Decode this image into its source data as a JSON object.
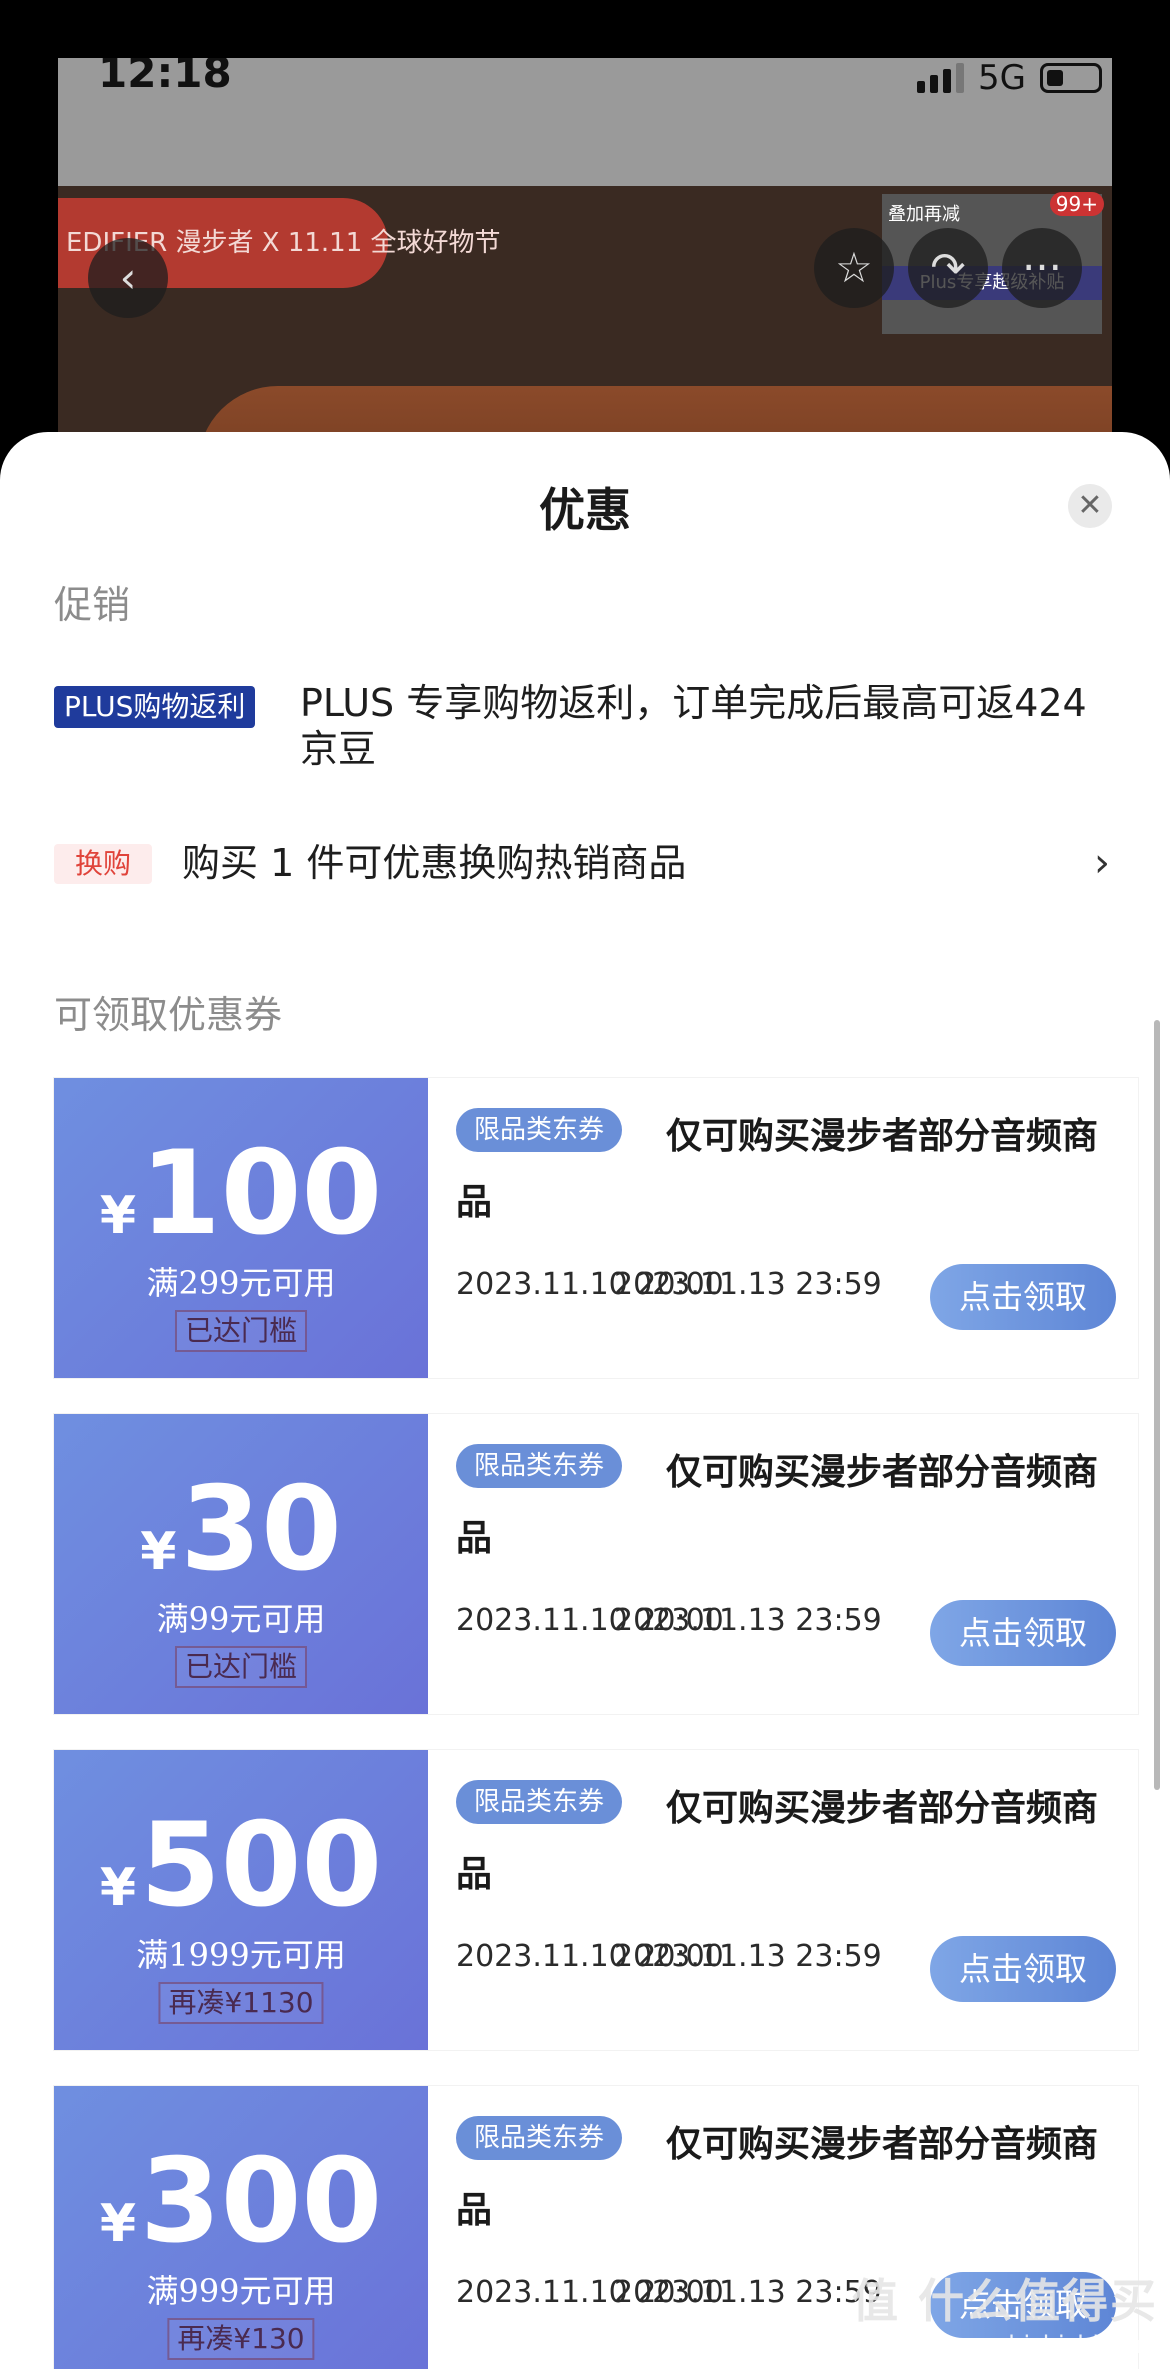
{
  "status_bar": {
    "time": "12:18",
    "network": "5G"
  },
  "background": {
    "banner_text": "EDIFIER 漫步者 X 11.11 全球好物节",
    "promo_side": "叠加再减",
    "promo_strip": "Plus专享超级补贴",
    "promo_count": "99+"
  },
  "sheet": {
    "title": "优惠",
    "sections": {
      "promo": "促销",
      "coupons": "可领取优惠券"
    },
    "promotions": [
      {
        "tag": "PLUS购物返利",
        "text": "PLUS 专享购物返利，订单完成后最高可返424 京豆"
      },
      {
        "tag": "换购",
        "text": "购买 1 件可优惠换购热销商品"
      }
    ],
    "coupons": [
      {
        "currency": "¥",
        "amount": "100",
        "threshold": "满299元可用",
        "status": "已达门槛",
        "tag": "限品类东券",
        "desc": "仅可购买漫步者部分音频商品",
        "start": "2023.11.10 20:00",
        "end": "2023.11.13 23:59",
        "button": "点击领取"
      },
      {
        "currency": "¥",
        "amount": "30",
        "threshold": "满99元可用",
        "status": "已达门槛",
        "tag": "限品类东券",
        "desc": "仅可购买漫步者部分音频商品",
        "start": "2023.11.10 20:00",
        "end": "2023.11.13 23:59",
        "button": "点击领取"
      },
      {
        "currency": "¥",
        "amount": "500",
        "threshold": "满1999元可用",
        "status": "再凑¥1130",
        "tag": "限品类东券",
        "desc": "仅可购买漫步者部分音频商品",
        "start": "2023.11.10 20:00",
        "end": "2023.11.13 23:59",
        "button": "点击领取"
      },
      {
        "currency": "¥",
        "amount": "300",
        "threshold": "满999元可用",
        "status": "再凑¥130",
        "tag": "限品类东券",
        "desc": "仅可购买漫步者部分音频商品",
        "start": "2023.11.10 20:00",
        "end": "2023.11.13 23:59",
        "button": "点击领取"
      }
    ]
  },
  "watermark": {
    "text": "值 什么值得买",
    "url": "zhizhizhi.com"
  },
  "icons": {
    "back": "back-arrow-icon",
    "favorite": "star-icon",
    "share": "share-icon",
    "more": "more-icon",
    "close": "close-icon",
    "chevron": "chevron-right-icon"
  }
}
